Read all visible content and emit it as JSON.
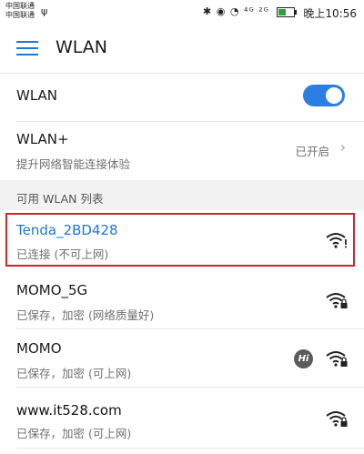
{
  "status_bar": {
    "carrier_1": "中国联通",
    "carrier_2": "中国联通",
    "icons": "✱ ◉ ◔ ⁴ᴳ ²ᴳ",
    "time": "晚上10:56"
  },
  "header": {
    "title": "WLAN"
  },
  "wlan_toggle": {
    "label": "WLAN",
    "on": true
  },
  "wlan_plus": {
    "label": "WLAN+",
    "subtitle": "提升网络智能连接体验",
    "value": "已开启"
  },
  "section": {
    "label": "可用 WLAN 列表"
  },
  "networks": [
    {
      "name": "Tenda_2BD428",
      "status": "已连接 (不可上网)",
      "icon": "wifi-warning-icon",
      "highlighted": true
    },
    {
      "name": "MOMO_5G",
      "status": "已保存，加密 (网络质量好)",
      "icon": "wifi-lock-icon"
    },
    {
      "name": "MOMO",
      "status": "已保存，加密 (可上网)",
      "icon": "wifi-lock-icon",
      "badge": "Hi"
    },
    {
      "name": "",
      "status": "已保存，加密 (可上网)",
      "icon": "wifi-lock-icon"
    }
  ],
  "watermark": "www.it528.com",
  "colors": {
    "accent": "#1f78d1",
    "highlight_border": "#d3242b"
  }
}
